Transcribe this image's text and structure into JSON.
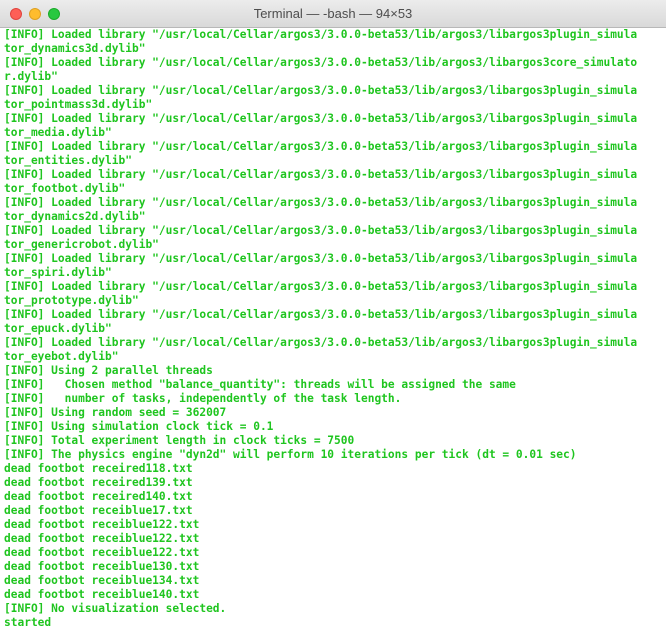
{
  "window": {
    "title": "Terminal — -bash — 94×53"
  },
  "terminal": {
    "lines": [
      "[INFO] Loaded library \"/usr/local/Cellar/argos3/3.0.0-beta53/lib/argos3/libargos3plugin_simula",
      "tor_dynamics3d.dylib\"",
      "[INFO] Loaded library \"/usr/local/Cellar/argos3/3.0.0-beta53/lib/argos3/libargos3core_simulato",
      "r.dylib\"",
      "[INFO] Loaded library \"/usr/local/Cellar/argos3/3.0.0-beta53/lib/argos3/libargos3plugin_simula",
      "tor_pointmass3d.dylib\"",
      "[INFO] Loaded library \"/usr/local/Cellar/argos3/3.0.0-beta53/lib/argos3/libargos3plugin_simula",
      "tor_media.dylib\"",
      "[INFO] Loaded library \"/usr/local/Cellar/argos3/3.0.0-beta53/lib/argos3/libargos3plugin_simula",
      "tor_entities.dylib\"",
      "[INFO] Loaded library \"/usr/local/Cellar/argos3/3.0.0-beta53/lib/argos3/libargos3plugin_simula",
      "tor_footbot.dylib\"",
      "[INFO] Loaded library \"/usr/local/Cellar/argos3/3.0.0-beta53/lib/argos3/libargos3plugin_simula",
      "tor_dynamics2d.dylib\"",
      "[INFO] Loaded library \"/usr/local/Cellar/argos3/3.0.0-beta53/lib/argos3/libargos3plugin_simula",
      "tor_genericrobot.dylib\"",
      "[INFO] Loaded library \"/usr/local/Cellar/argos3/3.0.0-beta53/lib/argos3/libargos3plugin_simula",
      "tor_spiri.dylib\"",
      "[INFO] Loaded library \"/usr/local/Cellar/argos3/3.0.0-beta53/lib/argos3/libargos3plugin_simula",
      "tor_prototype.dylib\"",
      "[INFO] Loaded library \"/usr/local/Cellar/argos3/3.0.0-beta53/lib/argos3/libargos3plugin_simula",
      "tor_epuck.dylib\"",
      "[INFO] Loaded library \"/usr/local/Cellar/argos3/3.0.0-beta53/lib/argos3/libargos3plugin_simula",
      "tor_eyebot.dylib\"",
      "[INFO] Using 2 parallel threads",
      "[INFO]   Chosen method \"balance_quantity\": threads will be assigned the same",
      "[INFO]   number of tasks, independently of the task length.",
      "[INFO] Using random seed = 362007",
      "[INFO] Using simulation clock tick = 0.1",
      "[INFO] Total experiment length in clock ticks = 7500",
      "[INFO] The physics engine \"dyn2d\" will perform 10 iterations per tick (dt = 0.01 sec)",
      "dead footbot receired118.txt",
      "dead footbot receired139.txt",
      "dead footbot receired140.txt",
      "dead footbot receiblue17.txt",
      "dead footbot receiblue122.txt",
      "dead footbot receiblue122.txt",
      "dead footbot receiblue122.txt",
      "dead footbot receiblue130.txt",
      "dead footbot receiblue134.txt",
      "dead footbot receiblue140.txt",
      "[INFO] No visualization selected.",
      "started"
    ]
  },
  "colors": {
    "text": "#1fc51f",
    "background": "#ffffff",
    "close": "#fe5f57",
    "minimize": "#febc2e",
    "zoom": "#28c840"
  }
}
